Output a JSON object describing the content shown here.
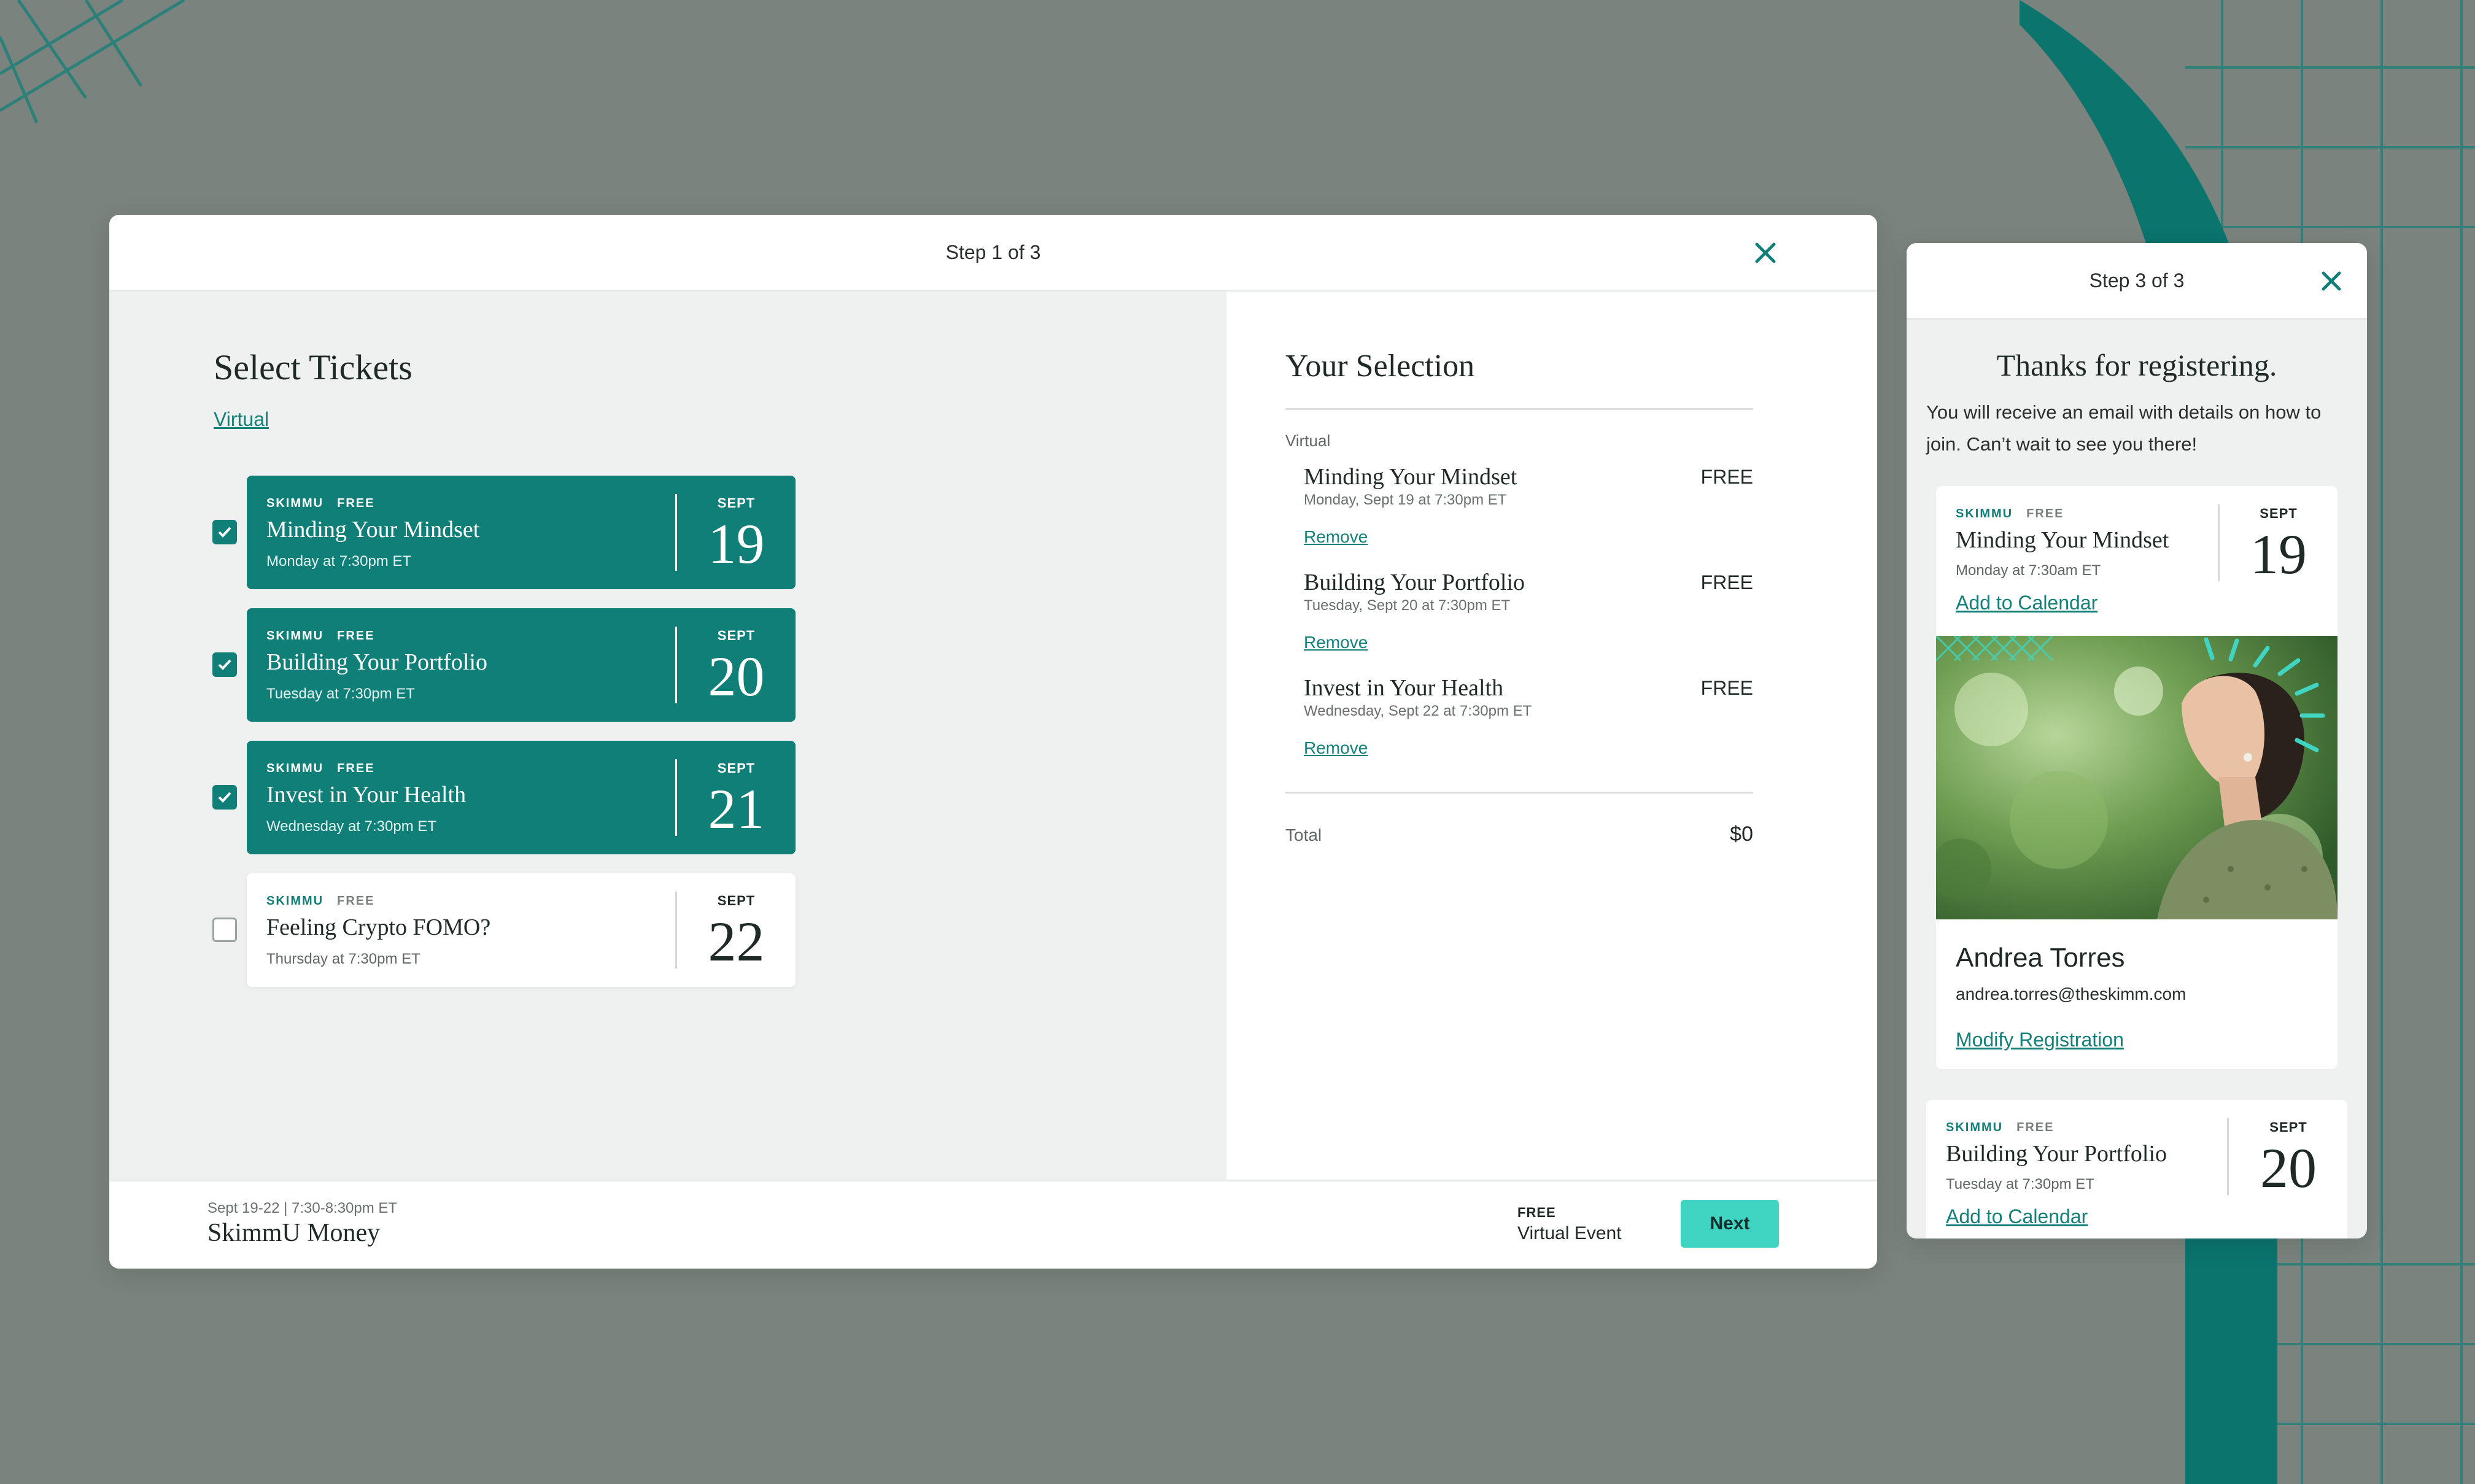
{
  "colors": {
    "background": "#7a837d",
    "teal": "#0f7f77",
    "accent": "#3fd5c2",
    "link": "#14807a"
  },
  "modal_select": {
    "step": "Step 1 of 3",
    "close_icon": "close-icon",
    "title": "Select Tickets",
    "filter_link": "Virtual",
    "tickets": [
      {
        "brand": "SKIMMU",
        "price": "FREE",
        "name": "Minding Your Mindset",
        "time": "Monday at 7:30pm ET",
        "month": "SEPT",
        "day": "19",
        "checked": true
      },
      {
        "brand": "SKIMMU",
        "price": "FREE",
        "name": "Building Your Portfolio",
        "time": "Tuesday at 7:30pm ET",
        "month": "SEPT",
        "day": "20",
        "checked": true
      },
      {
        "brand": "SKIMMU",
        "price": "FREE",
        "name": "Invest in Your Health",
        "time": "Wednesday at 7:30pm ET",
        "month": "SEPT",
        "day": "21",
        "checked": true
      },
      {
        "brand": "SKIMMU",
        "price": "FREE",
        "name": "Feeling Crypto FOMO?",
        "time": "Thursday at 7:30pm ET",
        "month": "SEPT",
        "day": "22",
        "checked": false
      }
    ],
    "selection": {
      "title": "Your Selection",
      "section": "Virtual",
      "items": [
        {
          "name": "Minding Your Mindset",
          "date": "Monday, Sept 19 at 7:30pm ET",
          "price": "FREE",
          "remove": "Remove"
        },
        {
          "name": "Building Your Portfolio",
          "date": "Tuesday, Sept 20 at 7:30pm ET",
          "price": "FREE",
          "remove": "Remove"
        },
        {
          "name": "Invest in Your Health",
          "date": "Wednesday, Sept 22 at 7:30pm ET",
          "price": "FREE",
          "remove": "Remove"
        }
      ],
      "total_label": "Total",
      "total_value": "$0"
    },
    "footer": {
      "date": "Sept 19-22 | 7:30-8:30pm ET",
      "event_title": "SkimmU Money",
      "price": "FREE",
      "event_type": "Virtual Event",
      "next_label": "Next"
    }
  },
  "modal_confirm": {
    "step": "Step 3 of 3",
    "close_icon": "close-icon",
    "title": "Thanks for registering.",
    "message": "You will receive an email with details on how to join. Can’t wait to see you there!",
    "card1": {
      "brand": "SKIMMU",
      "price": "FREE",
      "name": "Minding Your Mindset",
      "time": "Monday at 7:30am ET",
      "month": "SEPT",
      "day": "19",
      "calendar_link": "Add to Calendar"
    },
    "photo_icon": "woman-portrait-photo",
    "attendee": {
      "name": "Andrea Torres",
      "email": "andrea.torres@theskimm.com",
      "modify_link": "Modify Registration"
    },
    "card2": {
      "brand": "SKIMMU",
      "price": "FREE",
      "name": "Building Your Portfolio",
      "time": "Tuesday at 7:30pm ET",
      "month": "SEPT",
      "day": "20",
      "calendar_link": "Add to Calendar"
    }
  }
}
